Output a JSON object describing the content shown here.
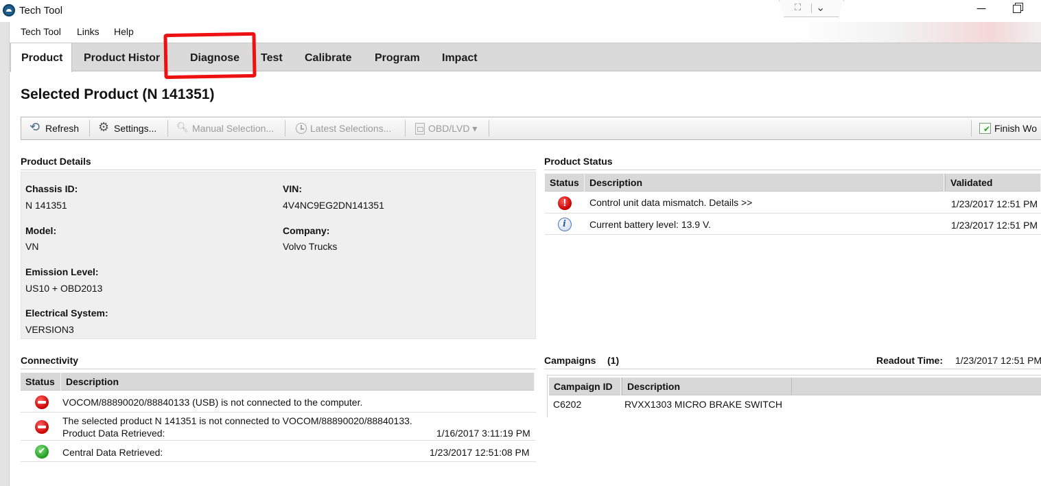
{
  "window": {
    "title": "Tech Tool",
    "expand_glyph": "⛶",
    "chevron_glyph": "⌄",
    "minimize_glyph": "─"
  },
  "menu": [
    "Tech Tool",
    "Links",
    "Help"
  ],
  "tabs": [
    "Product",
    "Product Histor",
    "Diagnose",
    "Test",
    "Calibrate",
    "Program",
    "Impact"
  ],
  "page_title": "Selected Product (N 141351)",
  "toolbar": {
    "refresh": "Refresh",
    "settings": "Settings...",
    "manual_selection": "Manual Selection...",
    "latest_selections": "Latest Selections...",
    "obd_lvd": "OBD/LVD ▾",
    "finish": "Finish Wo"
  },
  "product_details": {
    "heading": "Product Details",
    "chassis_label": "Chassis ID:",
    "chassis_value": "N 141351",
    "vin_label": "VIN:",
    "vin_value": "4V4NC9EG2DN141351",
    "model_label": "Model:",
    "model_value": "VN",
    "company_label": "Company:",
    "company_value": "Volvo Trucks",
    "emission_label": "Emission Level:",
    "emission_value": "US10 + OBD2013",
    "electrical_label": "Electrical System:",
    "electrical_value": "VERSION3"
  },
  "product_status": {
    "heading": "Product Status",
    "columns": [
      "Status",
      "Description",
      "Validated"
    ],
    "rows": [
      {
        "icon": "error-icon",
        "description": "Control unit data mismatch. Details >>",
        "validated": "1/23/2017 12:51 PM"
      },
      {
        "icon": "info-icon",
        "description": "Current battery level: 13.9 V.",
        "validated": "1/23/2017 12:51 PM"
      }
    ]
  },
  "connectivity": {
    "heading": "Connectivity",
    "columns": [
      "Status",
      "Description"
    ],
    "rows": [
      {
        "icon": "stop-icon",
        "line1": "VOCOM/88890020/88840133 (USB) is not connected to the computer."
      },
      {
        "icon": "stop-icon",
        "line1": "The selected product N 141351 is not connected to VOCOM/88890020/88840133.",
        "line2": "Product Data Retrieved:",
        "time": "1/16/2017 3:11:19 PM"
      },
      {
        "icon": "check-icon",
        "line1": "Central Data Retrieved:",
        "time": "1/23/2017 12:51:08 PM"
      }
    ]
  },
  "campaigns": {
    "heading": "Campaigns",
    "count": "(1)",
    "readout_label": "Readout Time:",
    "readout_value": "1/23/2017 12:51 PM",
    "columns": [
      "Campaign ID",
      "Description"
    ],
    "rows": [
      {
        "id": "C6202",
        "description": "RVXX1303 MICRO BRAKE SWITCH"
      }
    ]
  },
  "colors": {
    "highlight": "#ee1111",
    "tab_bar": "#dadada",
    "panel": "#efefef"
  }
}
